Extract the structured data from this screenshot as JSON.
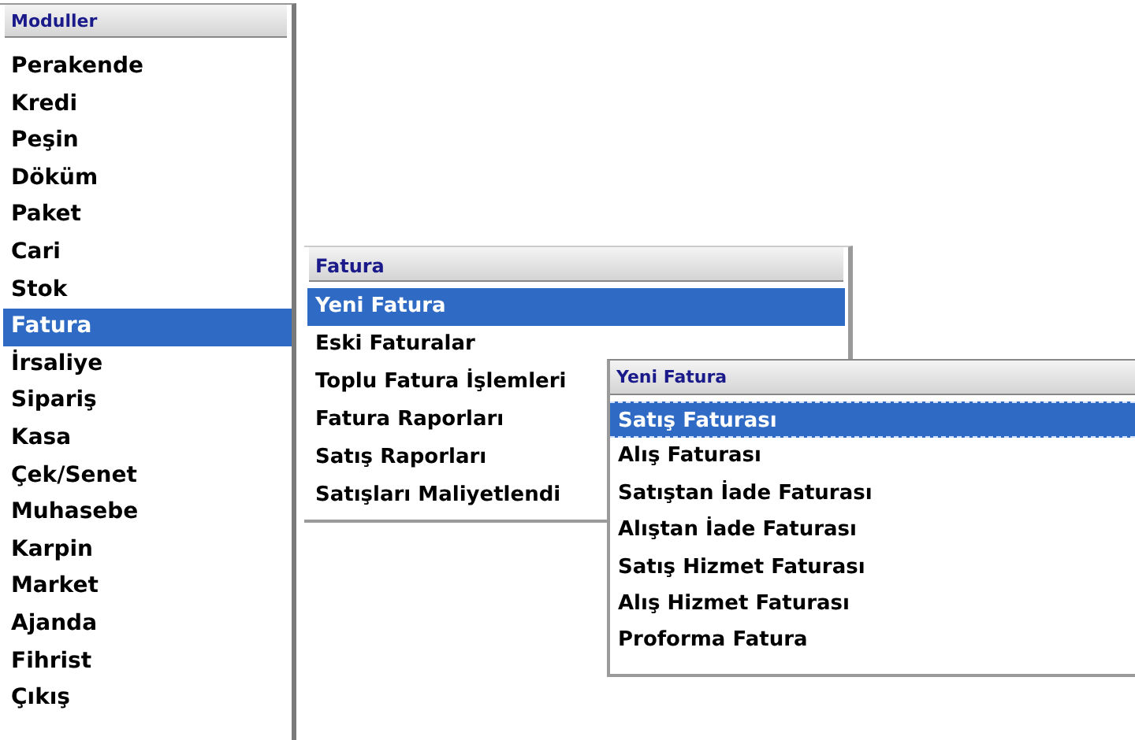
{
  "modules_panel": {
    "title": "Moduller",
    "items": [
      {
        "label": "Perakende",
        "selected": false
      },
      {
        "label": "Kredi",
        "selected": false
      },
      {
        "label": "Peşin",
        "selected": false
      },
      {
        "label": "Döküm",
        "selected": false
      },
      {
        "label": "Paket",
        "selected": false
      },
      {
        "label": "Cari",
        "selected": false
      },
      {
        "label": "Stok",
        "selected": false
      },
      {
        "label": "Fatura",
        "selected": true
      },
      {
        "label": "İrsaliye",
        "selected": false
      },
      {
        "label": "Sipariş",
        "selected": false
      },
      {
        "label": "Kasa",
        "selected": false
      },
      {
        "label": "Çek/Senet",
        "selected": false
      },
      {
        "label": "Muhasebe",
        "selected": false
      },
      {
        "label": "Karpin",
        "selected": false
      },
      {
        "label": "Market",
        "selected": false
      },
      {
        "label": "Ajanda",
        "selected": false
      },
      {
        "label": "Fihrist",
        "selected": false
      },
      {
        "label": "Çıkış",
        "selected": false
      }
    ]
  },
  "fatura_panel": {
    "title": "Fatura",
    "items": [
      {
        "label": "Yeni Fatura",
        "selected": true
      },
      {
        "label": "Eski Faturalar",
        "selected": false
      },
      {
        "label": "Toplu Fatura İşlemleri",
        "selected": false
      },
      {
        "label": "Fatura Raporları",
        "selected": false
      },
      {
        "label": "Satış Raporları",
        "selected": false
      },
      {
        "label": "Satışları Maliyetlendi",
        "selected": false
      }
    ]
  },
  "yeni_fatura_panel": {
    "title": "Yeni Fatura",
    "items": [
      {
        "label": "Satış Faturası",
        "selected": true
      },
      {
        "label": "Alış Faturası",
        "selected": false
      },
      {
        "label": "Satıştan İade Faturası",
        "selected": false
      },
      {
        "label": "Alıştan İade Faturası",
        "selected": false
      },
      {
        "label": "Satış Hizmet Faturası",
        "selected": false
      },
      {
        "label": "Alış Hizmet Faturası",
        "selected": false
      },
      {
        "label": "Proforma Fatura",
        "selected": false
      }
    ]
  }
}
